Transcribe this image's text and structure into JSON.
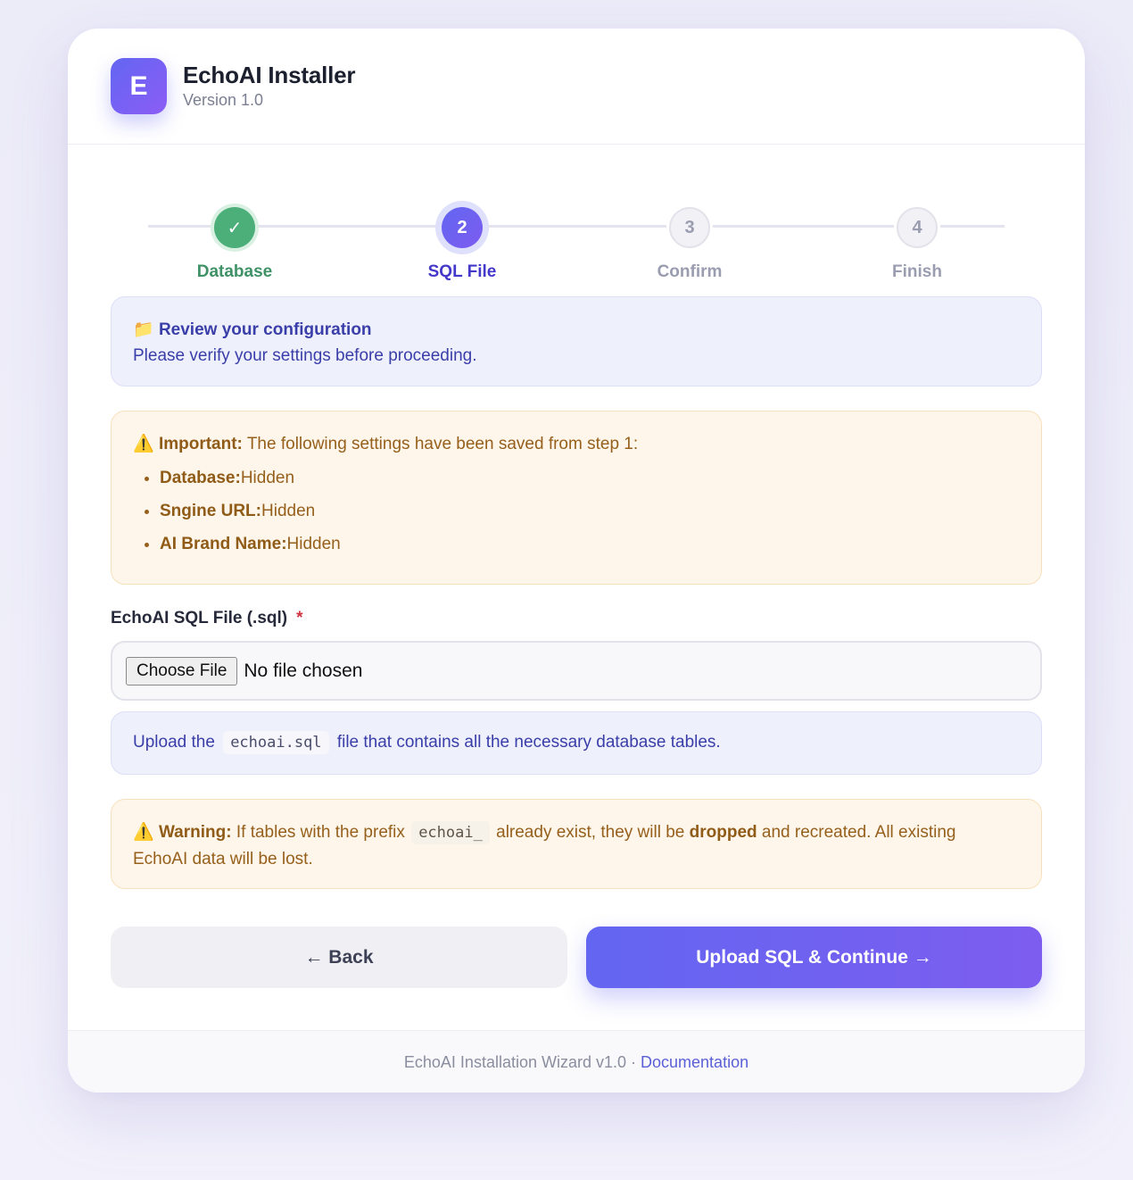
{
  "header": {
    "logo_letter": "E",
    "title": "EchoAI Installer",
    "version": "Version 1.0"
  },
  "steps": [
    {
      "number": "✓",
      "label": "Database",
      "state": "done"
    },
    {
      "number": "2",
      "label": "SQL File",
      "state": "active"
    },
    {
      "number": "3",
      "label": "Confirm",
      "state": "pending"
    },
    {
      "number": "4",
      "label": "Finish",
      "state": "pending"
    }
  ],
  "review": {
    "icon": "📁",
    "title": "Review your configuration",
    "description": "Please verify your settings before proceeding."
  },
  "important": {
    "icon": "⚠️",
    "label": "Important:",
    "text": "The following settings have been saved from step 1:",
    "items": [
      {
        "key": "Database:",
        "value": "Hidden"
      },
      {
        "key": "Sngine URL:",
        "value": "Hidden"
      },
      {
        "key": "AI Brand Name:",
        "value": "Hidden"
      }
    ]
  },
  "sql_field": {
    "label": "EchoAI SQL File (.sql)",
    "required_marker": "*",
    "button_label": "Choose File",
    "status": "No file chosen"
  },
  "hint": {
    "before": "Upload the",
    "code": "echoai.sql",
    "after": "file that contains all the necessary database tables."
  },
  "warning": {
    "icon": "⚠️",
    "label": "Warning:",
    "text1": "If tables with the prefix",
    "code": "echoai_",
    "text2": "already exist, they will be",
    "emphasis": "dropped",
    "text3": "and recreated. All existing EchoAI data will be lost."
  },
  "buttons": {
    "back": "← Back",
    "next": "Upload SQL & Continue →"
  },
  "footer": {
    "text": "EchoAI Installation Wizard v1.0",
    "separator": "·",
    "link": "Documentation"
  },
  "colors": {
    "accent": "#6366f1",
    "success": "#4caf7a",
    "warning_text": "#96601c",
    "info_text": "#3b3ea8"
  }
}
